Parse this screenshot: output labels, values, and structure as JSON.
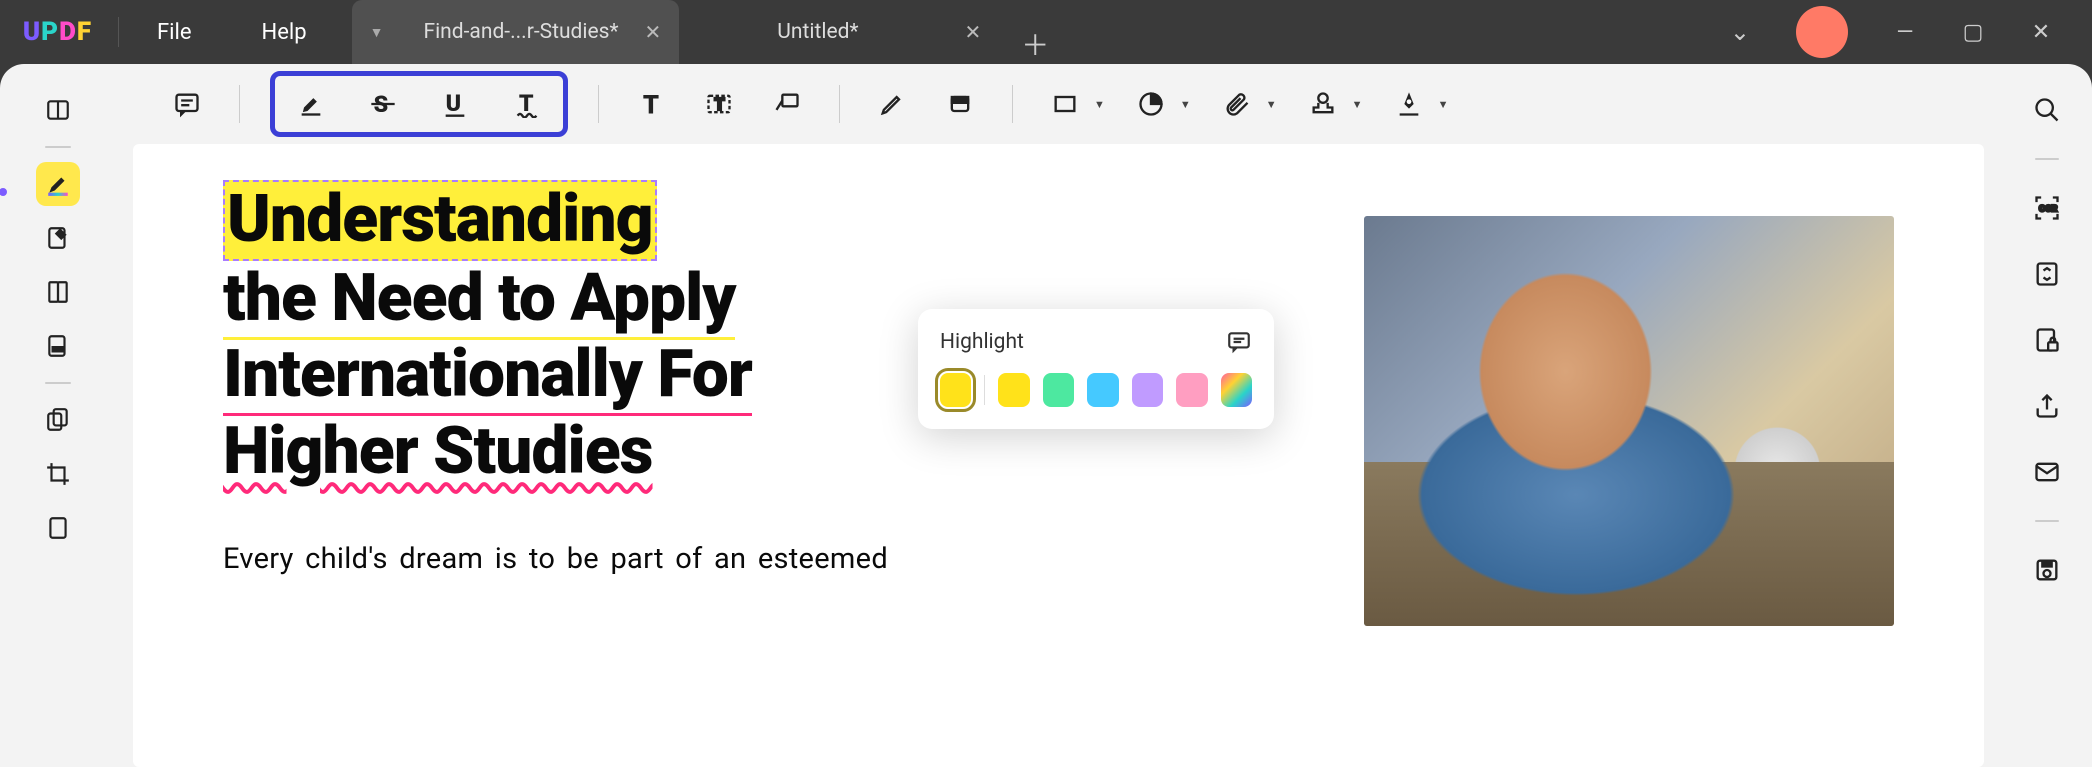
{
  "app": {
    "logo": "UPDF"
  },
  "menu": {
    "file": "File",
    "help": "Help"
  },
  "tabs": {
    "active": {
      "title": "Find-and-...r-Studies*"
    },
    "second": {
      "title": "Untitled*"
    }
  },
  "popup": {
    "title": "Highlight",
    "swatches": [
      "#ffe21a",
      "#ffe21a",
      "#4de8a0",
      "#45c9ff",
      "#c09bff",
      "#ff9ec1",
      "gradient"
    ]
  },
  "document": {
    "h1_word1": "Understanding",
    "h1_line2": "the Need to Apply",
    "h1_line3": "Internationally For",
    "h1_line4": "Higher Studies",
    "body1": "Every child's dream is to be part of an esteemed"
  }
}
